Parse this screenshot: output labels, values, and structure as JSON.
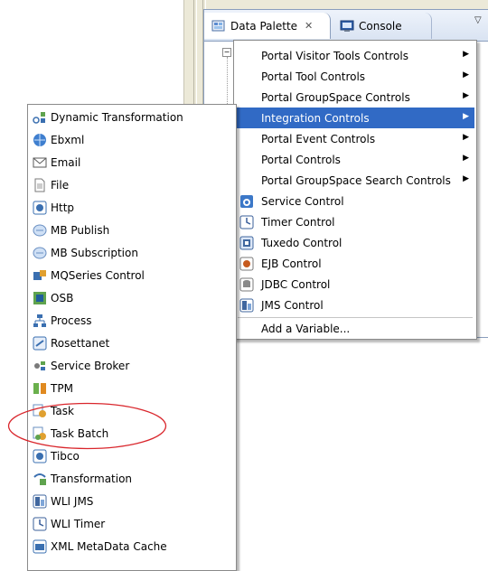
{
  "tabs": [
    {
      "label": "Data Palette",
      "close": "✕",
      "icon": "data-palette-icon"
    },
    {
      "label": "Console",
      "icon": "console-icon"
    }
  ],
  "view_menu_glyph": "▽",
  "tree_toggle": "−",
  "main_menu": {
    "items": [
      {
        "label": "Portal Visitor Tools Controls",
        "submenu": true
      },
      {
        "label": "Portal Tool Controls",
        "submenu": true
      },
      {
        "label": "Portal GroupSpace Controls",
        "submenu": true
      },
      {
        "label": "Integration Controls",
        "submenu": true,
        "highlighted": true
      },
      {
        "label": "Portal Event Controls",
        "submenu": true
      },
      {
        "label": "Portal Controls",
        "submenu": true
      },
      {
        "label": "Portal GroupSpace Search Controls",
        "submenu": true
      },
      {
        "label": "Service Control",
        "icon": "service-control-icon"
      },
      {
        "label": "Timer Control",
        "icon": "timer-control-icon"
      },
      {
        "label": "Tuxedo Control",
        "icon": "tuxedo-control-icon"
      },
      {
        "label": "EJB Control",
        "icon": "ejb-control-icon"
      },
      {
        "label": "JDBC Control",
        "icon": "jdbc-control-icon"
      },
      {
        "label": "JMS Control",
        "icon": "jms-control-icon"
      }
    ],
    "footer_item": "Add a Variable...",
    "arrow_glyph": "▶"
  },
  "integration_submenu": {
    "items": [
      {
        "label": "Dynamic Transformation",
        "icon": "dynamic-transformation-icon"
      },
      {
        "label": "Ebxml",
        "icon": "ebxml-icon"
      },
      {
        "label": "Email",
        "icon": "email-icon"
      },
      {
        "label": "File",
        "icon": "file-icon"
      },
      {
        "label": "Http",
        "icon": "http-icon"
      },
      {
        "label": "MB Publish",
        "icon": "mb-publish-icon"
      },
      {
        "label": "MB Subscription",
        "icon": "mb-subscription-icon"
      },
      {
        "label": "MQSeries Control",
        "icon": "mqseries-icon"
      },
      {
        "label": "OSB",
        "icon": "osb-icon"
      },
      {
        "label": "Process",
        "icon": "process-icon"
      },
      {
        "label": "Rosettanet",
        "icon": "rosettanet-icon"
      },
      {
        "label": "Service Broker",
        "icon": "service-broker-icon"
      },
      {
        "label": "TPM",
        "icon": "tpm-icon"
      },
      {
        "label": "Task",
        "icon": "task-icon"
      },
      {
        "label": "Task Batch",
        "icon": "task-batch-icon"
      },
      {
        "label": "Tibco",
        "icon": "tibco-icon"
      },
      {
        "label": "Transformation",
        "icon": "transformation-icon"
      },
      {
        "label": "WLI JMS",
        "icon": "wli-jms-icon"
      },
      {
        "label": "WLI Timer",
        "icon": "wli-timer-icon"
      },
      {
        "label": "XML MetaData Cache",
        "icon": "xml-metadata-cache-icon"
      }
    ]
  },
  "colors": {
    "highlight": "#316ac5",
    "annotation": "#d9262c"
  }
}
